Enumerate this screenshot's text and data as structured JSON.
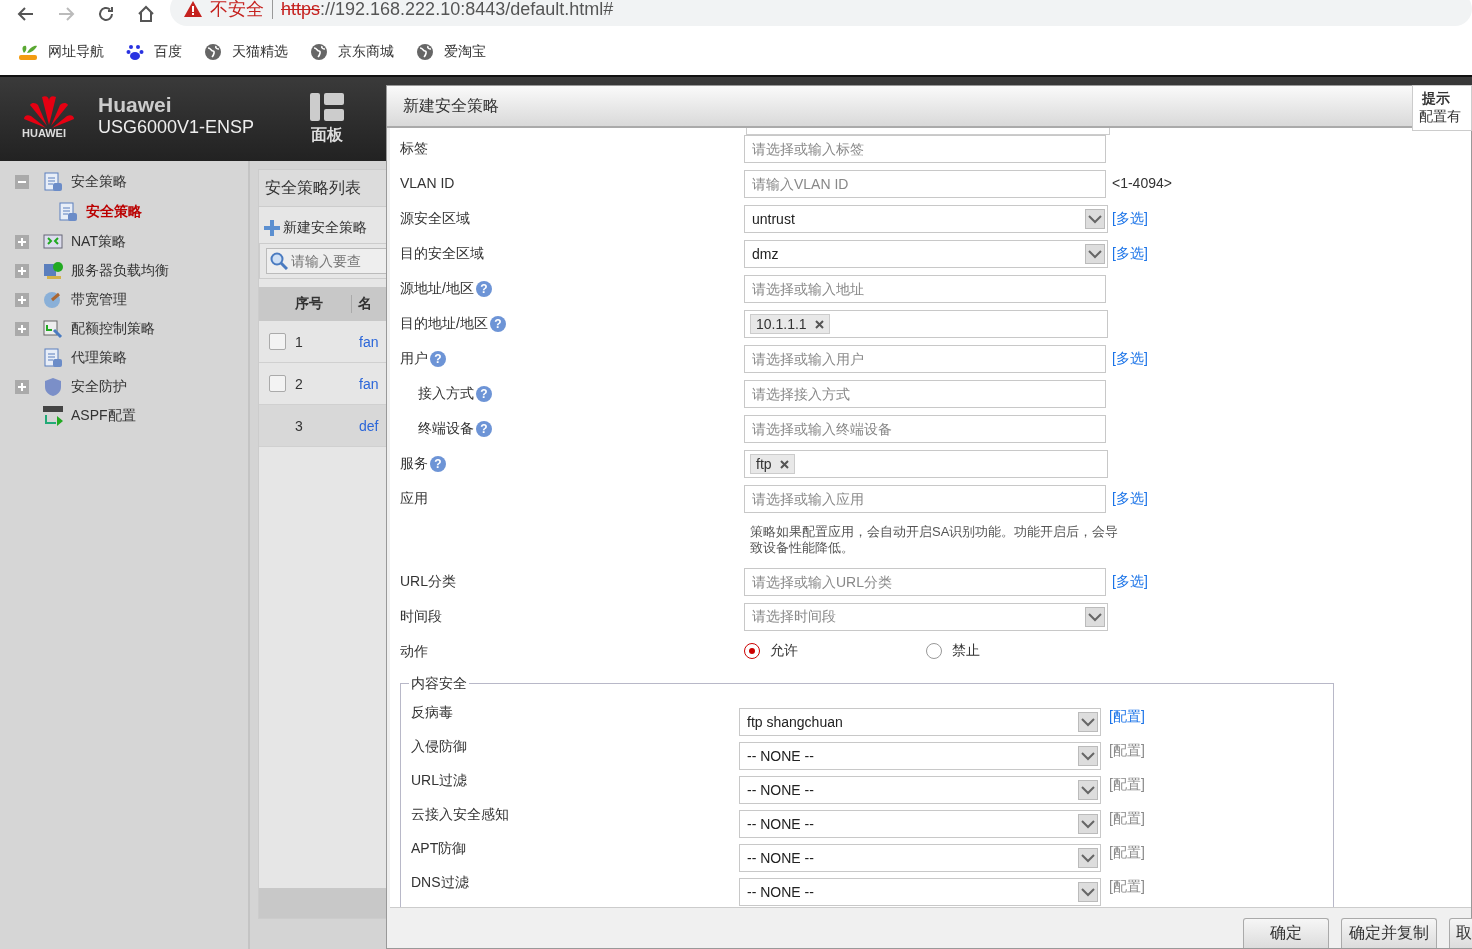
{
  "browser": {
    "back_disabled": false,
    "forward_disabled": true,
    "security": "不安全",
    "url_scheme": "https",
    "url_rest": "://192.168.222.10:8443/default.html#",
    "bookmarks": [
      {
        "label": "网址导航",
        "kind": "hao"
      },
      {
        "label": "百度",
        "kind": "paw"
      },
      {
        "label": "天猫精选",
        "kind": "globe"
      },
      {
        "label": "京东商城",
        "kind": "globe"
      },
      {
        "label": "爱淘宝",
        "kind": "globe"
      }
    ]
  },
  "header": {
    "logo_text": "HUAWEI",
    "brand": "Huawei",
    "model": "USG6000V1-ENSP",
    "panel": "面板"
  },
  "sidebar": {
    "items": [
      {
        "label": "安全策略",
        "expanded": true,
        "selected": false,
        "children": [
          {
            "label": "安全策略",
            "selected": true
          }
        ]
      },
      {
        "label": "NAT策略",
        "expanded": false,
        "selected": false
      },
      {
        "label": "服务器负载均衡",
        "expanded": false,
        "selected": false
      },
      {
        "label": "带宽管理",
        "expanded": false,
        "selected": false
      },
      {
        "label": "配额控制策略",
        "expanded": false,
        "selected": false
      },
      {
        "label": "代理策略",
        "selected": false
      },
      {
        "label": "安全防护",
        "expanded": false,
        "selected": false
      },
      {
        "label": "ASPF配置",
        "selected": false
      }
    ]
  },
  "list": {
    "title": "安全策略列表",
    "new_button": "新建安全策略",
    "search": {
      "placeholder": "请输入要查"
    },
    "columns": [
      "序号",
      "名"
    ],
    "rows": [
      {
        "index": "1",
        "name": "fan",
        "checkbox": true,
        "selected": false
      },
      {
        "index": "2",
        "name": "fan",
        "checkbox": true,
        "selected": false
      },
      {
        "index": "3",
        "name": "def",
        "checkbox": false,
        "selected": true
      }
    ]
  },
  "dialog": {
    "title": "新建安全策略",
    "fields": [
      {
        "kind": "input",
        "label": "标签",
        "placeholder": "请选择或输入标签"
      },
      {
        "kind": "input",
        "label": "VLAN ID",
        "placeholder": "请输入VLAN ID",
        "suffix": "<1-4094>"
      },
      {
        "kind": "select",
        "label": "源安全区域",
        "value": "untrust",
        "link": "[多选]"
      },
      {
        "kind": "select",
        "label": "目的安全区域",
        "value": "dmz",
        "link": "[多选]"
      },
      {
        "kind": "input",
        "label": "源地址/地区",
        "help": "?",
        "placeholder": "请选择或输入地址"
      },
      {
        "kind": "tags",
        "label": "目的地址/地区",
        "help": "?",
        "tags": [
          "10.1.1.1"
        ]
      },
      {
        "kind": "input",
        "label": "用户",
        "help": "?",
        "placeholder": "请选择或输入用户",
        "link": "[多选]"
      },
      {
        "kind": "input",
        "label": "接入方式",
        "help": "?",
        "indent": true,
        "placeholder": "请选择接入方式"
      },
      {
        "kind": "input",
        "label": "终端设备",
        "help": "?",
        "indent": true,
        "placeholder": "请选择或输入终端设备"
      },
      {
        "kind": "tags",
        "label": "服务",
        "help": "?",
        "tags": [
          "ftp"
        ]
      },
      {
        "kind": "input",
        "label": "应用",
        "placeholder": "请选择或输入应用",
        "link": "[多选]",
        "note": "策略如果配置应用，会自动开启SA识别功能。功能开启后，会导致设备性能降低。"
      },
      {
        "kind": "input",
        "label": "URL分类",
        "placeholder": "请选择或输入URL分类",
        "link": "[多选]"
      },
      {
        "kind": "select",
        "label": "时间段",
        "placeholder": "请选择时间段"
      },
      {
        "kind": "radio",
        "label": "动作",
        "options": [
          {
            "label": "允许",
            "selected": true
          },
          {
            "label": "禁止",
            "selected": false
          }
        ]
      }
    ],
    "content_security": {
      "legend": "内容安全",
      "rows": [
        {
          "label": "反病毒",
          "value": "ftp shangchuan",
          "link": "[配置]",
          "link_disabled": false
        },
        {
          "label": "入侵防御",
          "value": "-- NONE --",
          "link": "[配置]",
          "link_disabled": true
        },
        {
          "label": "URL过滤",
          "value": "-- NONE --",
          "link": "[配置]",
          "link_disabled": true
        },
        {
          "label": "云接入安全感知",
          "value": "-- NONE --",
          "link": "[配置]",
          "link_disabled": true
        },
        {
          "label": "APT防御",
          "value": "-- NONE --",
          "link": "[配置]",
          "link_disabled": true
        },
        {
          "label": "DNS过滤",
          "value": "-- NONE --",
          "link": "[配置]",
          "link_disabled": true
        }
      ]
    },
    "buttons": [
      "确定",
      "确定并复制",
      "取"
    ]
  },
  "tip": {
    "title": "提示",
    "text": "配置有"
  }
}
